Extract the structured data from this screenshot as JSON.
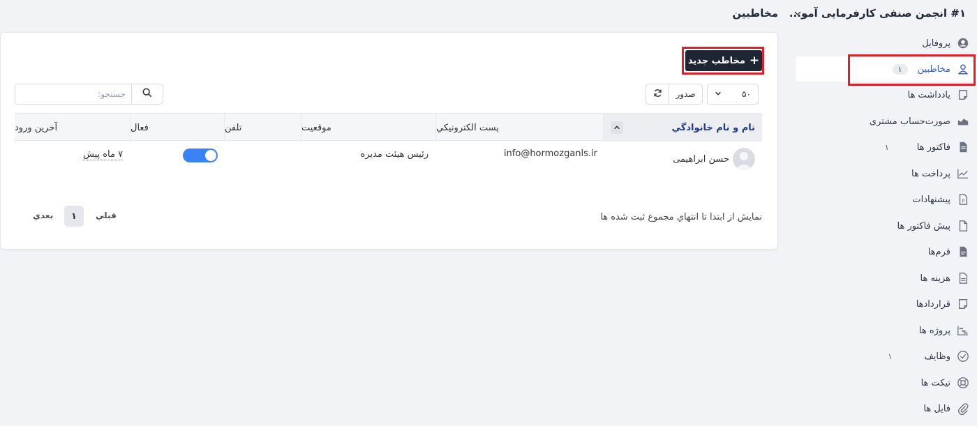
{
  "header": {
    "company": "#۱ انجمن صنفی کارفرمایی آمو...",
    "page_title": "مخاطبین"
  },
  "sidebar": {
    "items": [
      {
        "label": "پروفایل",
        "icon": "user-circle-icon",
        "count": ""
      },
      {
        "label": "مخاطبین",
        "icon": "user-icon",
        "count": "۱",
        "active": true
      },
      {
        "label": "یادداشت ها",
        "icon": "note-icon",
        "count": ""
      },
      {
        "label": "صورت‌حساب مشتری",
        "icon": "area-chart-icon",
        "count": ""
      },
      {
        "label": "فاکتور ها",
        "icon": "invoice-icon",
        "count": "۱"
      },
      {
        "label": "پرداخت ها",
        "icon": "line-chart-icon",
        "count": ""
      },
      {
        "label": "پیشنهادات",
        "icon": "proposal-icon",
        "count": ""
      },
      {
        "label": "پیش فاکتور ها",
        "icon": "file-icon",
        "count": ""
      },
      {
        "label": "فرم‌ها",
        "icon": "form-icon",
        "count": ""
      },
      {
        "label": "هزینه ها",
        "icon": "expense-icon",
        "count": ""
      },
      {
        "label": "قراردادها",
        "icon": "contract-icon",
        "count": ""
      },
      {
        "label": "پروژه ها",
        "icon": "gantt-icon",
        "count": ""
      },
      {
        "label": "وظایف",
        "icon": "check-circle-icon",
        "count": "۱"
      },
      {
        "label": "تیکت ها",
        "icon": "lifebuoy-icon",
        "count": ""
      },
      {
        "label": "فایل ها",
        "icon": "paperclip-icon",
        "count": ""
      }
    ]
  },
  "toolbar": {
    "new_contact": "مخاطب جدید",
    "search_placeholder": "جستجو:",
    "export": "صدور",
    "page_size": "۵۰"
  },
  "table": {
    "columns": [
      "نام و نام خانوادگي",
      "پست الكترونيكي",
      "موقعيت",
      "تلفن",
      "فعال",
      "آخرين ورود"
    ],
    "rows": [
      {
        "name": "حسن ابراهیمی",
        "email": "info@hormozganls.ir",
        "position": "رئیس هیئت مدیره",
        "phone": "",
        "active": true,
        "last_login": "۷ ماه پیش"
      }
    ]
  },
  "footer": {
    "info": "نمايش از ابتدا تا انتهاي مجموع ثبت شده ها",
    "prev": "قبلي",
    "page": "۱",
    "next": "بعدي"
  },
  "colors": {
    "accent": "#3b5bdb",
    "button_dark": "#1f2633",
    "toggle_on": "#3b82f6",
    "highlight": "#e11d2a"
  }
}
